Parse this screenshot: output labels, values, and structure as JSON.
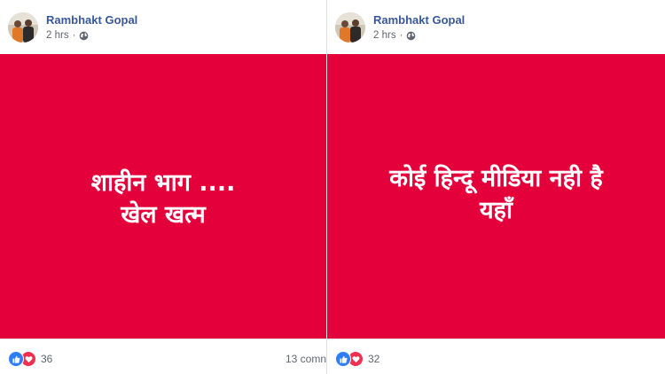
{
  "colors": {
    "banner_red": "#e4003a",
    "author_blue": "#385898",
    "like_blue": "#2f7ef7",
    "love_red": "#f0304e"
  },
  "posts": [
    {
      "author": "Rambhakt Gopal",
      "time": "2 hrs",
      "separator": "·",
      "privacy_icon": "globe-icon",
      "banner_lines": [
        "शाहीन भाग ....",
        "खेल खत्म"
      ],
      "reaction_icons": [
        "like-icon",
        "love-icon"
      ],
      "reaction_count": "36",
      "comments": "13 comn"
    },
    {
      "author": "Rambhakt Gopal",
      "time": "2 hrs",
      "separator": "·",
      "privacy_icon": "globe-icon",
      "banner_lines": [
        "कोई हिन्दू मीडिया नही है",
        "यहाँ"
      ],
      "reaction_icons": [
        "like-icon",
        "love-icon"
      ],
      "reaction_count": "32"
    }
  ]
}
